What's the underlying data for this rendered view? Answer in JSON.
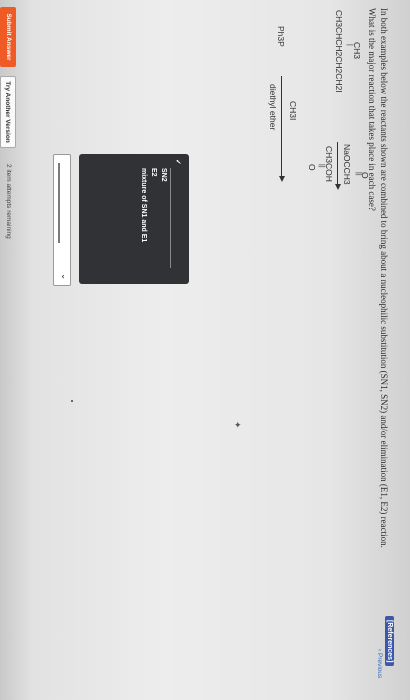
{
  "header": {
    "references_label": "[References]"
  },
  "question": {
    "line1": "In both examples below the reactants shown are combined to bring about a nucleophilic substitution (SN1, SN2) and/or elimination (E1, E2) reaction.",
    "line2": "What is the major reaction that takes place in each case?"
  },
  "reaction1": {
    "substrate_branch": "CH3",
    "substrate": "CH3CHCH2CH2CH2I",
    "reagent_top": "O",
    "reagent_bond": "||",
    "reagent": "NaOCCH3",
    "solvent": "CH3COH",
    "solvent_bond": "||",
    "solvent_bottom": "O"
  },
  "reaction2": {
    "substrate": "Ph3P",
    "reagent": "CH3I",
    "solvent": "diethyl ether"
  },
  "dropdown": {
    "check": "✓",
    "options": [
      "SN2",
      "E2",
      "mixture of SN1 and E1"
    ]
  },
  "select2": {
    "arrow": "⌄"
  },
  "actions": {
    "submit_label": "Submit Answer",
    "try_label": "Try Another Version",
    "attempts_text": "2 item attempts remaining"
  },
  "nav": {
    "previous_label": "Previous"
  }
}
